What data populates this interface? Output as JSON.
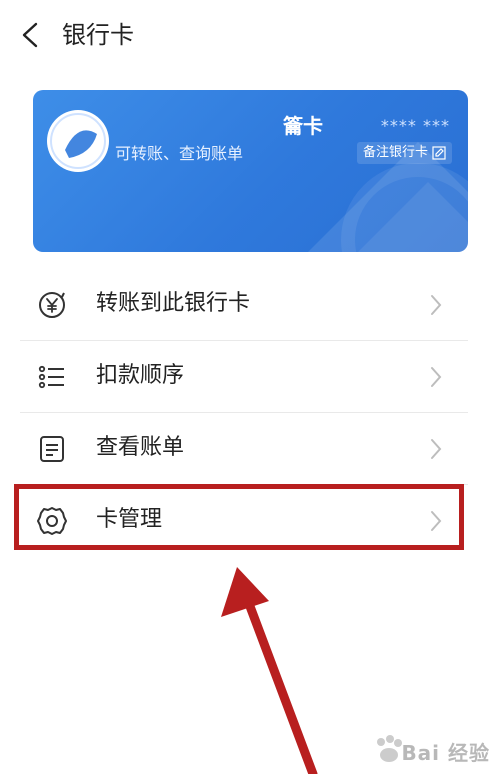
{
  "header": {
    "title": "银行卡"
  },
  "card": {
    "bank_name": "籥卡",
    "description": "可转账、查询账单",
    "card_number": "**** ***",
    "note_button": "备注银行卡",
    "colors": {
      "start": "#3e8ee8",
      "end": "#2a6fd3"
    }
  },
  "menu": {
    "items": [
      {
        "label": "转账到此银行卡",
        "icon": "yuan-transfer-icon"
      },
      {
        "label": "扣款顺序",
        "icon": "list-icon"
      },
      {
        "label": "查看账单",
        "icon": "document-icon"
      },
      {
        "label": "卡管理",
        "icon": "gear-icon"
      }
    ]
  },
  "annotation": {
    "highlight_color": "#b81f1f"
  },
  "watermark": {
    "text": "Bai 经验"
  }
}
